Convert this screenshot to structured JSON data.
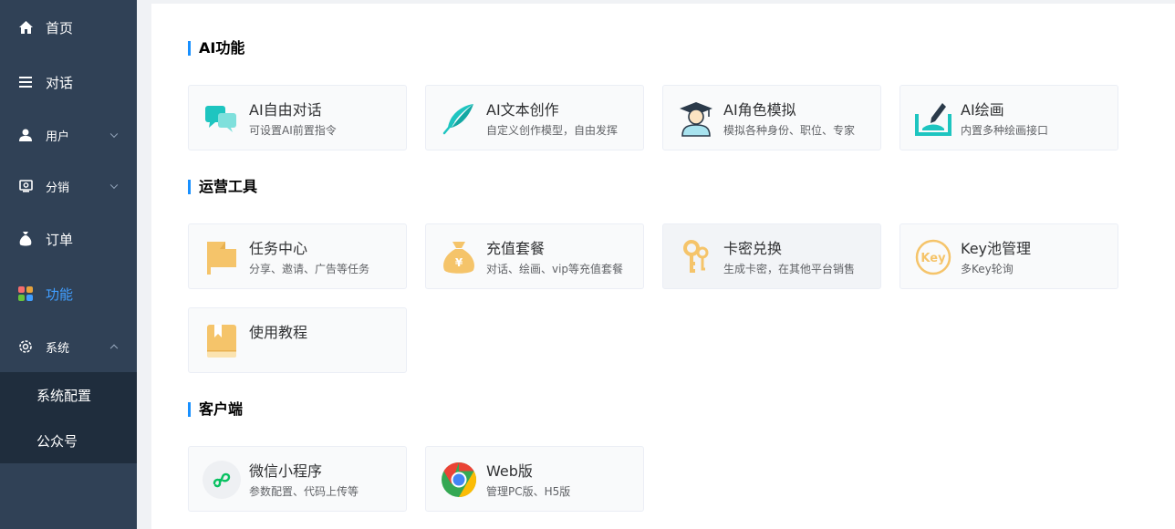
{
  "sidebar": {
    "items": [
      {
        "label": "首页",
        "icon": "home-icon"
      },
      {
        "label": "对话",
        "icon": "list-icon"
      },
      {
        "label": "用户",
        "icon": "user-icon"
      },
      {
        "label": "分销",
        "icon": "distribution-icon"
      },
      {
        "label": "订单",
        "icon": "money-bag-icon"
      },
      {
        "label": "功能",
        "icon": "grid-icon"
      },
      {
        "label": "系统",
        "icon": "gear-icon"
      }
    ],
    "sub_items": [
      "系统配置",
      "公众号"
    ]
  },
  "sections": [
    {
      "title": "AI功能",
      "cards": [
        {
          "title": "AI自由对话",
          "desc": "可设置AI前置指令",
          "icon": "chat-bubbles-icon"
        },
        {
          "title": "AI文本创作",
          "desc": "自定义创作模型，自由发挥",
          "icon": "feather-icon"
        },
        {
          "title": "AI角色模拟",
          "desc": "模拟各种身份、职位、专家",
          "icon": "graduate-icon"
        },
        {
          "title": "AI绘画",
          "desc": "内置多种绘画接口",
          "icon": "paint-brush-icon"
        }
      ]
    },
    {
      "title": "运营工具",
      "cards": [
        {
          "title": "任务中心",
          "desc": "分享、邀请、广告等任务",
          "icon": "flag-icon"
        },
        {
          "title": "充值套餐",
          "desc": "对话、绘画、vip等充值套餐",
          "icon": "money-bag-icon"
        },
        {
          "title": "卡密兑换",
          "desc": "生成卡密，在其他平台销售",
          "icon": "keys-icon"
        },
        {
          "title": "Key池管理",
          "desc": "多Key轮询",
          "icon": "key-badge-icon",
          "badge": "Key"
        },
        {
          "title": "使用教程",
          "desc": "",
          "icon": "book-icon"
        }
      ]
    },
    {
      "title": "客户端",
      "cards": [
        {
          "title": "微信小程序",
          "desc": "参数配置、代码上传等",
          "icon": "mini-program-icon"
        },
        {
          "title": "Web版",
          "desc": "管理PC版、H5版",
          "icon": "chrome-icon"
        }
      ]
    }
  ],
  "colors": {
    "sidebar_bg": "#304156",
    "submenu_bg": "#1f2d3d",
    "active": "#409eff",
    "accent_bar": "#1890ff",
    "teal": "#1ec5c0",
    "orange": "#f5c46a"
  }
}
